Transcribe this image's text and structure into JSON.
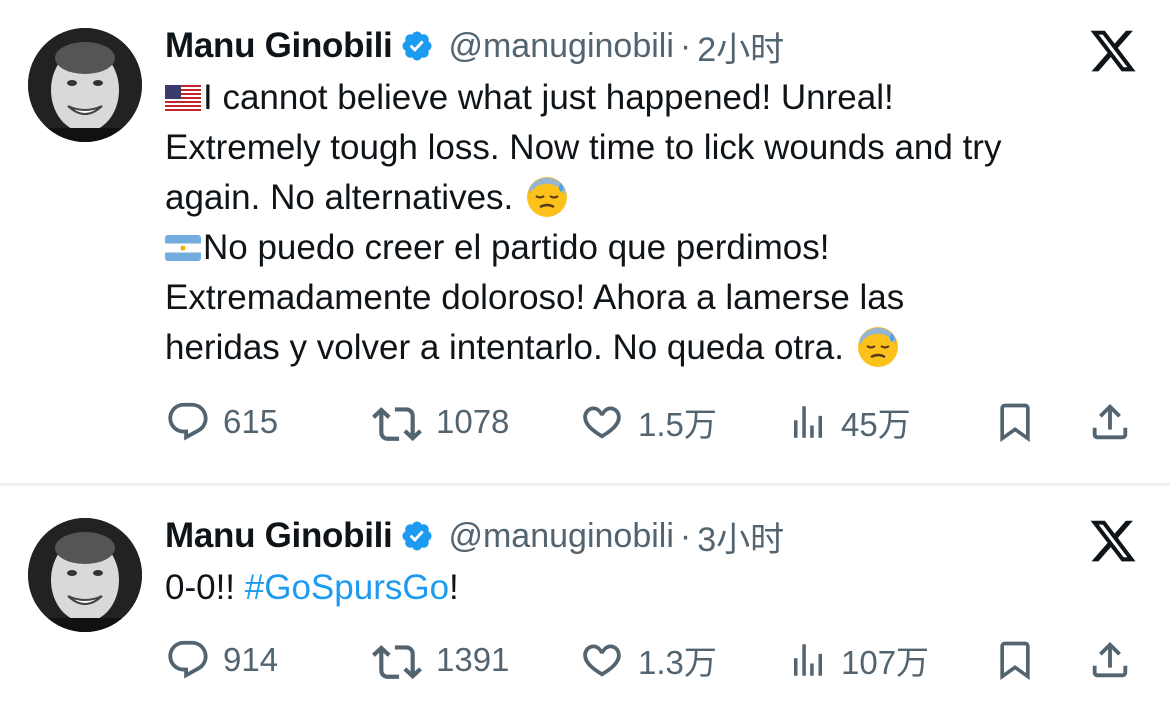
{
  "tweets": [
    {
      "author": {
        "display_name": "Manu Ginobili",
        "handle": "@manuginobili",
        "verified": true,
        "avatar": "avatar-photo"
      },
      "separator": "·",
      "time": "2小时",
      "lines": [
        {
          "flag": "us-flag",
          "text": "I cannot believe what just happened! Unreal!"
        },
        {
          "text": "Extremely tough loss. Now time to lick wounds and try"
        },
        {
          "text": "again. No alternatives.",
          "emoji": "downcast-sweat-emoji"
        },
        {
          "flag": "argentina-flag",
          "text": "No puedo creer el partido que perdimos!"
        },
        {
          "text": "Extremadamente doloroso! Ahora a lamerse las"
        },
        {
          "text": "heridas y volver a intentarlo. No queda otra.",
          "emoji": "downcast-sweat-emoji"
        }
      ],
      "actions": {
        "replies": "615",
        "retweets": "1078",
        "likes": "1.5万",
        "views": "45万"
      }
    },
    {
      "author": {
        "display_name": "Manu Ginobili",
        "handle": "@manuginobili",
        "verified": true,
        "avatar": "avatar-photo"
      },
      "separator": "·",
      "time": "3小时",
      "lines": [
        {
          "text": "0-0!! ",
          "hashtag": "#GoSpursGo",
          "suffix": "!"
        }
      ],
      "actions": {
        "replies": "914",
        "retweets": "1391",
        "likes": "1.3万",
        "views": "107万"
      }
    }
  ],
  "icons": {
    "reply": "reply-icon",
    "retweet": "retweet-icon",
    "like": "heart-icon",
    "views": "views-icon",
    "bookmark": "bookmark-icon",
    "share": "share-icon",
    "platform": "x-logo-icon",
    "verified": "verified-badge-icon"
  },
  "colors": {
    "text": "#0f1419",
    "muted": "#536471",
    "link": "#1d9bf0",
    "verified": "#1d9bf0",
    "divider": "#eff3f4"
  }
}
